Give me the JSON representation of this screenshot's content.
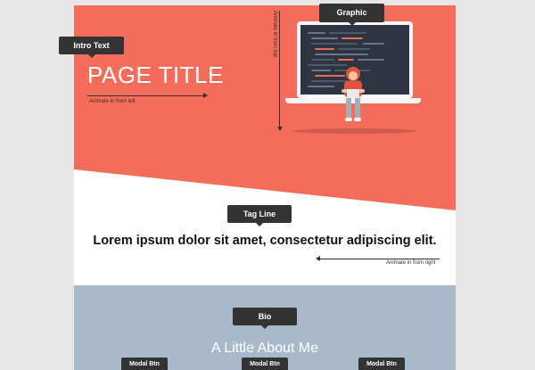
{
  "labels": {
    "intro_text": "Intro Text",
    "graphic": "Graphic",
    "tag_line": "Tag Line",
    "bio": "Bio",
    "modal_btn": "Modal Btn"
  },
  "hero": {
    "title": "PAGE TITLE",
    "anim_left": "Animate in from left",
    "anim_top": "Animate in from top"
  },
  "tagline": {
    "text": "Lorem ipsum dolor sit amet, consectetur adipiscing elit.",
    "anim_right": "Animate in from right"
  },
  "bio": {
    "heading": "A Little About Me"
  },
  "colors": {
    "hero_bg": "#f56c5b",
    "bio_bg": "#a9b9cc",
    "label_bg": "#333333"
  }
}
